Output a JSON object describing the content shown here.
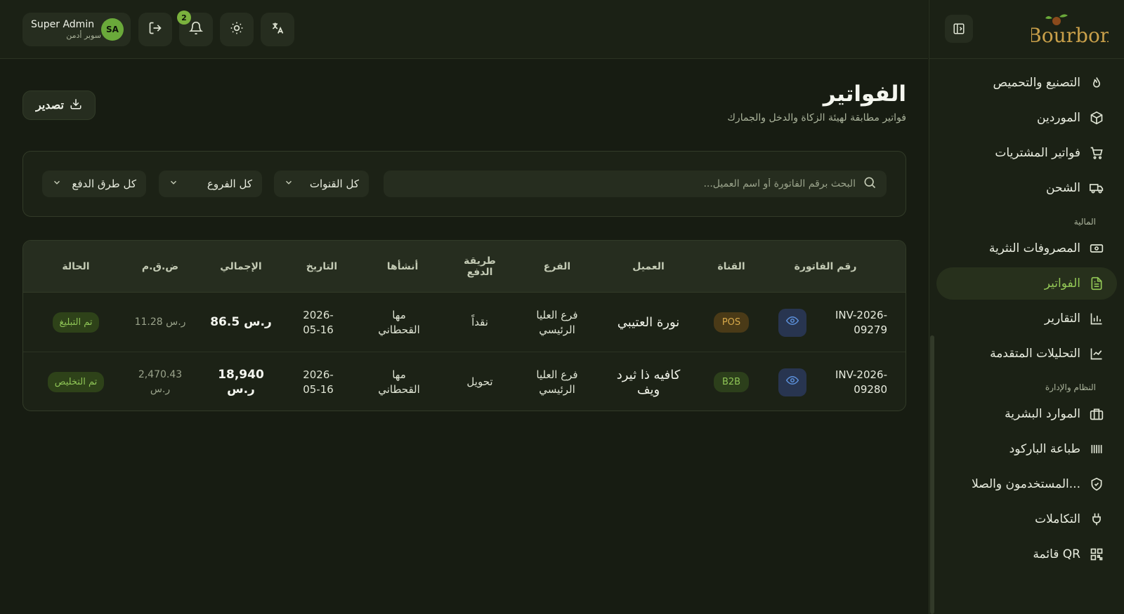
{
  "brand": {
    "logo_text": "Bourbon"
  },
  "user": {
    "name": "Super Admin",
    "role": "سوبر أدمن",
    "initials": "SA"
  },
  "notifications": {
    "count": "2"
  },
  "nav": {
    "items_top": [
      {
        "label": "التصنيع والتحميص",
        "icon": "flame-icon"
      },
      {
        "label": "الموردين",
        "icon": "package-icon"
      },
      {
        "label": "فواتير المشتريات",
        "icon": "cart-icon"
      },
      {
        "label": "الشحن",
        "icon": "truck-icon"
      }
    ],
    "section_finance": "المالية",
    "items_finance": [
      {
        "label": "المصروفات النثرية",
        "icon": "banknote-icon"
      },
      {
        "label": "الفواتير",
        "icon": "file-text-icon",
        "active": true
      },
      {
        "label": "التقارير",
        "icon": "bar-chart-icon"
      },
      {
        "label": "التحليلات المتقدمة",
        "icon": "line-chart-icon"
      }
    ],
    "section_system": "النظام والإدارة",
    "items_system": [
      {
        "label": "الموارد البشرية",
        "icon": "briefcase-icon"
      },
      {
        "label": "طباعة الباركود",
        "icon": "barcode-icon"
      },
      {
        "label": "المستخدمون والصلا...",
        "icon": "shield-icon"
      },
      {
        "label": "التكاملات",
        "icon": "plug-icon"
      },
      {
        "label": "قائمة QR",
        "icon": "qr-icon"
      }
    ]
  },
  "page": {
    "title": "الفواتير",
    "subtitle": "فواتير مطابقة لهيئة الزكاة والدخل والجمارك",
    "export_label": "تصدير"
  },
  "filters": {
    "search_placeholder": "البحث برقم الفاتورة أو اسم العميل...",
    "channels": "كل القنوات",
    "branches": "كل الفروع",
    "payment_methods": "كل طرق الدفع"
  },
  "table": {
    "headers": {
      "invoice_no": "رقم الفاتورة",
      "channel": "القناة",
      "customer": "العميل",
      "branch": "الفرع",
      "payment": "طريقة الدفع",
      "created_by": "أنشأها",
      "date": "التاريخ",
      "total": "الإجمالي",
      "vat": "ض.ق.م",
      "status": "الحالة"
    },
    "rows": [
      {
        "invoice_no": "INV-2026-09279",
        "channel": "POS",
        "customer": "نورة العتيبي",
        "branch": "فرع العليا الرئيسي",
        "payment": "نقداً",
        "created_by": "مها القحطاني",
        "date": "2026-05-16",
        "total": "86.5 ر.س",
        "vat": "11.28 ر.س",
        "status": "تم التبليغ"
      },
      {
        "invoice_no": "INV-2026-09280",
        "channel": "B2B",
        "customer": "كافيه ذا ثيرد ويف",
        "branch": "فرع العليا الرئيسي",
        "payment": "تحويل",
        "created_by": "مها القحطاني",
        "date": "2026-05-16",
        "total": "18,940 ر.س",
        "vat": "2,470.43 ر.س",
        "status": "تم التخليص"
      }
    ]
  },
  "colors": {
    "accent": "#93c756",
    "background": "#171c12",
    "panel": "#1b2115"
  }
}
